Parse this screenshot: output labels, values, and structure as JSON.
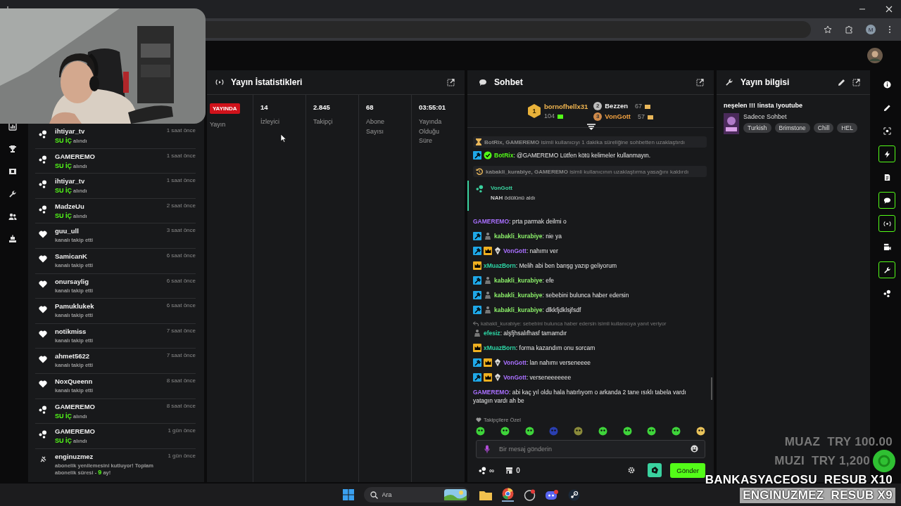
{
  "browser": {
    "profile_initial": "M"
  },
  "activity": {
    "items": [
      {
        "kind": "reward",
        "user": "ihtiyar_tv",
        "detail": "**SU İÇ** alındı",
        "time": "1 saat önce"
      },
      {
        "kind": "reward",
        "user": "GAMEREMO",
        "detail": "**SU İÇ** alındı",
        "time": "1 saat önce"
      },
      {
        "kind": "reward",
        "user": "ihtiyar_tv",
        "detail": "**SU İÇ** alındı",
        "time": "1 saat önce"
      },
      {
        "kind": "reward",
        "user": "MadzeUu",
        "detail": "**SU İÇ** alındı",
        "time": "2 saat önce"
      },
      {
        "kind": "follow",
        "user": "guu_ull",
        "detail": "kanalı takip etti",
        "time": "3 saat önce"
      },
      {
        "kind": "follow",
        "user": "SamicanK",
        "detail": "kanalı takip etti",
        "time": "6 saat önce"
      },
      {
        "kind": "follow",
        "user": "onursaylig",
        "detail": "kanalı takip etti",
        "time": "6 saat önce"
      },
      {
        "kind": "follow",
        "user": "Pamuklukek",
        "detail": "kanalı takip etti",
        "time": "6 saat önce"
      },
      {
        "kind": "follow",
        "user": "notikmiss",
        "detail": "kanalı takip etti",
        "time": "7 saat önce"
      },
      {
        "kind": "follow",
        "user": "ahmet5622",
        "detail": "kanalı takip etti",
        "time": "7 saat önce"
      },
      {
        "kind": "follow",
        "user": "NoxQueenn",
        "detail": "kanalı takip etti",
        "time": "8 saat önce"
      },
      {
        "kind": "reward",
        "user": "GAMEREMO",
        "detail": "**SU İÇ** alındı",
        "time": "8 saat önce"
      },
      {
        "kind": "reward",
        "user": "GAMEREMO",
        "detail": "**SU İÇ** alındı",
        "time": "1 gün önce"
      },
      {
        "kind": "resub",
        "user": "enginuzmez",
        "detail": "abonelik yenilemesini kutluyor! Toplam abonelik süresi - **9** ay!",
        "time": "1 gün önce"
      }
    ]
  },
  "stats": {
    "title": "Yayın İstatistikleri",
    "cells": [
      {
        "kind": "live",
        "badge": "YAYINDA",
        "label": "Yayın"
      },
      {
        "kind": "value",
        "value": "14",
        "label": "İzleyici"
      },
      {
        "kind": "value",
        "value": "2.845",
        "label": "Takipçi"
      },
      {
        "kind": "value",
        "value": "68",
        "label": "Abone Sayısı"
      },
      {
        "kind": "value",
        "value": "03:55:01",
        "label": "Yayında Olduğu Süre"
      }
    ]
  },
  "chat": {
    "title": "Sohbet",
    "leaderboard": [
      {
        "rank": "1",
        "name": "bornofhellx31",
        "score": "104"
      },
      {
        "rank": "2",
        "name": "Bezzen",
        "score": "67"
      },
      {
        "rank": "3",
        "name": "VonGott",
        "score": "57"
      }
    ],
    "messages": [
      {
        "kind": "timeout",
        "text": "**BotRix, GAMEREMO** isimli kullanıcıyı 1 dakika süreliğine sohbetten uzaklaştırdı"
      },
      {
        "kind": "chat",
        "badges": [
          {
            "kind": "mod"
          },
          {
            "kind": "verified"
          }
        ],
        "user": "BotRix",
        "color": "#53fc18",
        "text": ": @GAMEREMO Lütfen kötü kelimeler kullanmayın."
      },
      {
        "kind": "unban",
        "text": "**kabakli_kurabiye, GAMEREMO** isimli kullanıcının uzaklaştırma yasağını kaldırdı"
      },
      {
        "kind": "reward",
        "user": "VonGott",
        "color": "#3ad29f",
        "text": "**NAH** ödülünü aldı"
      },
      {
        "kind": "chat",
        "user": "GAMEREMO",
        "color": "#a970ff",
        "text": ": prta parmak deilmi o"
      },
      {
        "kind": "chat",
        "badges": [
          {
            "kind": "mod"
          },
          {
            "kind": "sub"
          }
        ],
        "user": "kabakli_kurabiye",
        "color": "#8cf06a",
        "text": ": nie ya"
      },
      {
        "kind": "chat",
        "badges": [
          {
            "kind": "mod"
          },
          {
            "kind": "vip"
          },
          {
            "kind": "og"
          }
        ],
        "user": "VonGott",
        "color": "#a970ff",
        "text": ": nahımı ver"
      },
      {
        "kind": "chat",
        "badges": [
          {
            "kind": "vip"
          }
        ],
        "user": "xMuazBorn",
        "color": "#2dd4a4",
        "text": ": Melih abi ben barışg yazıp geliyorum"
      },
      {
        "kind": "chat",
        "badges": [
          {
            "kind": "mod"
          },
          {
            "kind": "sub"
          }
        ],
        "user": "kabakli_kurabiye",
        "color": "#8cf06a",
        "text": ": efe"
      },
      {
        "kind": "chat",
        "badges": [
          {
            "kind": "mod"
          },
          {
            "kind": "sub"
          }
        ],
        "user": "kabakli_kurabiye",
        "color": "#8cf06a",
        "text": ": sebebini bulunca haber edersin"
      },
      {
        "kind": "chat",
        "badges": [
          {
            "kind": "mod"
          },
          {
            "kind": "sub"
          }
        ],
        "user": "kabakli_kurabiye",
        "color": "#8cf06a",
        "text": ": dlkkfjdklsjfsdf"
      },
      {
        "kind": "chat",
        "reply": "kabakli_kurabiye: sebebini bulunca haber edersin isimli kullanıcıya yanıt veriyor",
        "badges": [
          {
            "kind": "sub"
          }
        ],
        "user": "efesiz",
        "color": "#2dd4a4",
        "text": ": alşfjhsalıfhasf tamamdır"
      },
      {
        "kind": "chat",
        "badges": [
          {
            "kind": "vip"
          }
        ],
        "user": "xMuazBorn",
        "color": "#2dd4a4",
        "text": ": forma kazandım onu sorcam"
      },
      {
        "kind": "chat",
        "badges": [
          {
            "kind": "mod"
          },
          {
            "kind": "vip"
          },
          {
            "kind": "og"
          }
        ],
        "user": "VonGott",
        "color": "#a970ff",
        "text": ": lan nahımı verseneeee"
      },
      {
        "kind": "chat",
        "badges": [
          {
            "kind": "mod"
          },
          {
            "kind": "vip"
          },
          {
            "kind": "og"
          }
        ],
        "user": "VonGott",
        "color": "#a970ff",
        "text": ": verseneeeeeee"
      },
      {
        "kind": "chat",
        "user": "GAMEREMO",
        "color": "#a970ff",
        "text": ": abi kaç yıl oldu hala hatırlıyom o arkanda 2 tane ısıklı tabela vardı yatagın vardı ah be"
      }
    ],
    "emote_label": "Takipçilere Özel",
    "input": {
      "placeholder": "Bir mesaj gönderin"
    },
    "points": "∞",
    "shop_count": "0",
    "send": "Gönder"
  },
  "info": {
    "title": "Yayın bilgisi",
    "stream_title": "neşelen !!! !insta !youtube",
    "category": "Sadece Sohbet",
    "tags": [
      "Turkish",
      "Brimstone",
      "Chill",
      "HEL"
    ]
  },
  "toolbar": [
    {
      "selected": false
    },
    {
      "selected": false
    },
    {
      "selected": false
    },
    {
      "selected": true
    },
    {
      "selected": false
    },
    {
      "selected": true
    },
    {
      "selected": true
    },
    {
      "selected": false
    },
    {
      "selected": true
    },
    {
      "selected": false
    }
  ],
  "overlay": [
    {
      "kind": "donation",
      "text": "MUAZ  TRY 100.00",
      "highlighted": false
    },
    {
      "kind": "donation",
      "text": "MUZI  TRY 1,200",
      "highlighted": false
    },
    {
      "kind": "resub",
      "text": "BANKASYACEOSU  RESUB X10",
      "highlighted": false
    },
    {
      "kind": "resub",
      "text": "ENGINUZMEZ  RESUB X9",
      "highlighted": true
    }
  ],
  "taskbar": {
    "search": {
      "placeholder": "Ara"
    }
  }
}
